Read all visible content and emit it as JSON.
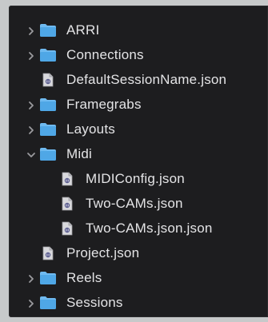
{
  "file_tree": {
    "items": [
      {
        "label": "ARRI",
        "kind": "folder",
        "expanded": false,
        "depth": 0
      },
      {
        "label": "Connections",
        "kind": "folder",
        "expanded": false,
        "depth": 0
      },
      {
        "label": "DefaultSessionName.json",
        "kind": "json-file",
        "depth": 0
      },
      {
        "label": "Framegrabs",
        "kind": "folder",
        "expanded": false,
        "depth": 0
      },
      {
        "label": "Layouts",
        "kind": "folder",
        "expanded": false,
        "depth": 0
      },
      {
        "label": "Midi",
        "kind": "folder",
        "expanded": true,
        "depth": 0
      },
      {
        "label": "MIDIConfig.json",
        "kind": "json-file",
        "depth": 1
      },
      {
        "label": "Two-CAMs.json",
        "kind": "json-file",
        "depth": 1
      },
      {
        "label": "Two-CAMs.json.json",
        "kind": "json-file",
        "depth": 1
      },
      {
        "label": "Project.json",
        "kind": "json-file",
        "depth": 0
      },
      {
        "label": "Reels",
        "kind": "folder",
        "expanded": false,
        "depth": 0
      },
      {
        "label": "Sessions",
        "kind": "folder",
        "expanded": false,
        "depth": 0
      }
    ]
  },
  "colors": {
    "folder_blue": "#4fa7e6",
    "folder_tab": "#6fbaf0",
    "text": "#e4e4e6",
    "chevron": "#9a9a9e",
    "panel_bg": "#1d1d1f",
    "file_icon_bg": "#d8d8dc"
  },
  "icons": {
    "folder": "folder-icon",
    "file": "json-file-icon",
    "collapsed": "chevron-right-icon",
    "expanded": "chevron-down-icon"
  }
}
